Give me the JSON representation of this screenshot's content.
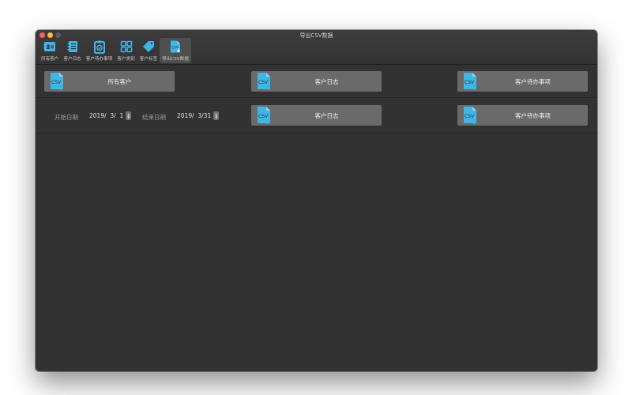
{
  "window": {
    "title": "导出CSV数据"
  },
  "toolbar": {
    "items": [
      {
        "label": "所有客户"
      },
      {
        "label": "客户日志"
      },
      {
        "label": "客户待办事项"
      },
      {
        "label": "客户类别"
      },
      {
        "label": "客户标签"
      },
      {
        "label": "导出CSV数据"
      }
    ],
    "active_index": 5
  },
  "export_rows": {
    "row1": [
      {
        "label": "所有客户"
      },
      {
        "label": "客户日志"
      },
      {
        "label": "客户待办事项"
      }
    ],
    "row2": {
      "start_label": "开始日期",
      "start_value": "2019/  3/  1",
      "end_label": "结束日期",
      "end_value": "2019/  3/31",
      "buttons": [
        {
          "label": "客户日志"
        },
        {
          "label": "客户待办事项"
        }
      ]
    }
  },
  "icons": {
    "csv_text": "CSV"
  },
  "colors": {
    "accent": "#3fb6e6",
    "window_bg": "#323232",
    "button_bg": "#6a6a6a"
  }
}
